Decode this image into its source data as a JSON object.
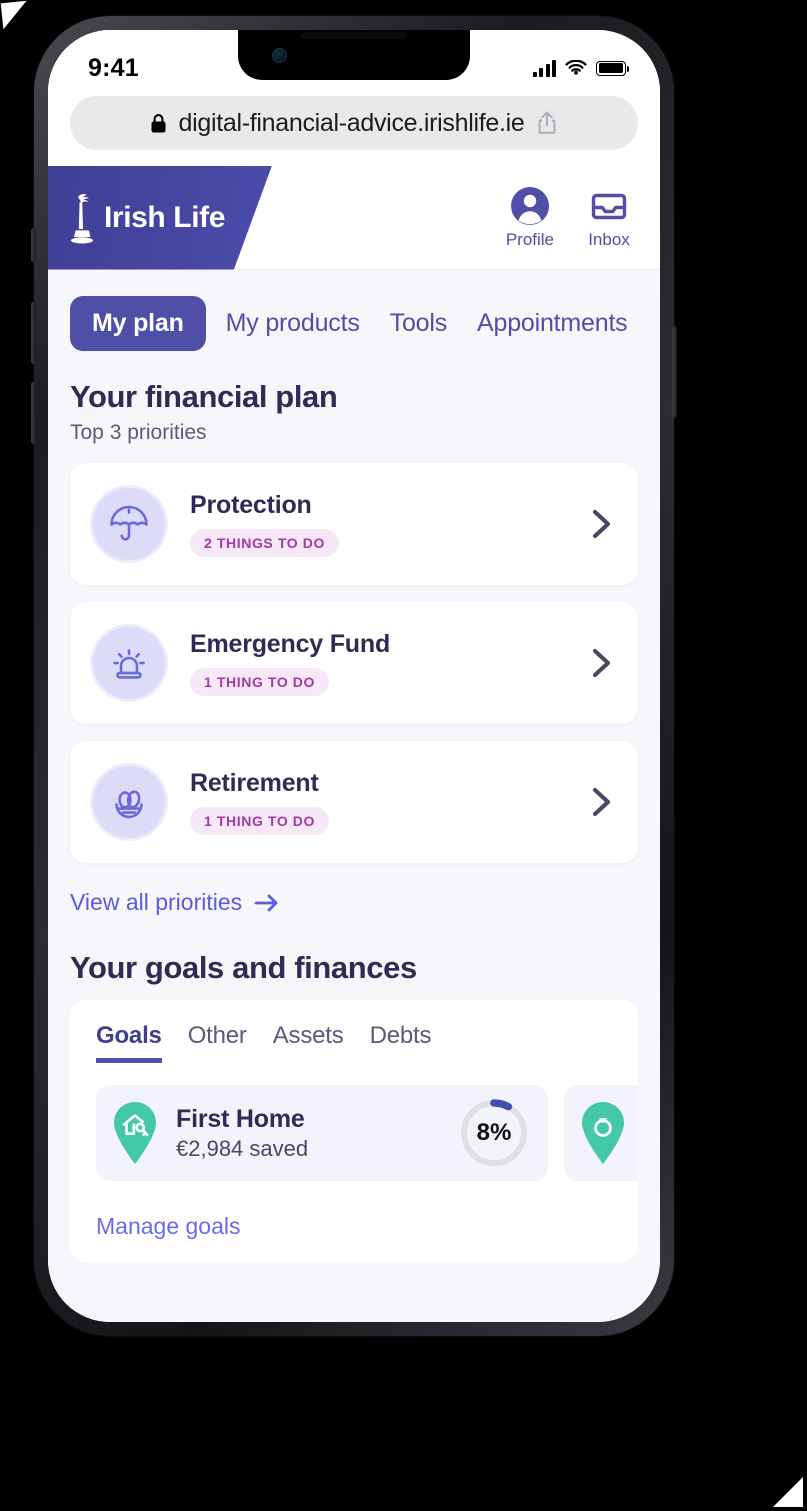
{
  "status_bar": {
    "time": "9:41",
    "signal_icon": "cellular-signal-icon",
    "wifi_icon": "wifi-icon",
    "battery_icon": "battery-icon"
  },
  "browser": {
    "lock_icon": "lock-icon",
    "url": "digital-financial-advice.irishlife.ie",
    "share_icon": "share-icon"
  },
  "header": {
    "brand": "Irish Life",
    "logo_icon": "irish-life-logo-icon",
    "actions": [
      {
        "label": "Profile",
        "icon": "profile-avatar-icon"
      },
      {
        "label": "Inbox",
        "icon": "inbox-tray-icon"
      }
    ]
  },
  "nav": {
    "tabs": [
      {
        "label": "My plan",
        "active": true
      },
      {
        "label": "My products",
        "active": false
      },
      {
        "label": "Tools",
        "active": false
      },
      {
        "label": "Appointments",
        "active": false
      }
    ]
  },
  "plan": {
    "title": "Your financial plan",
    "subtitle": "Top 3 priorities",
    "priorities": [
      {
        "title": "Protection",
        "badge": "2 THINGS TO DO",
        "icon": "umbrella-icon",
        "chevron": "chevron-right-icon"
      },
      {
        "title": "Emergency Fund",
        "badge": "1 THING TO DO",
        "icon": "alarm-siren-icon",
        "chevron": "chevron-right-icon"
      },
      {
        "title": "Retirement",
        "badge": "1 THING TO DO",
        "icon": "nest-egg-icon",
        "chevron": "chevron-right-icon"
      }
    ],
    "view_all_label": "View all priorities",
    "view_all_icon": "arrow-right-icon"
  },
  "goals_section": {
    "title": "Your goals and finances",
    "tabs": [
      {
        "label": "Goals",
        "active": true
      },
      {
        "label": "Other",
        "active": false
      },
      {
        "label": "Assets",
        "active": false
      },
      {
        "label": "Debts",
        "active": false
      }
    ],
    "goals": [
      {
        "name": "First Home",
        "saved": "€2,984 saved",
        "progress": "8%",
        "progress_value": 8,
        "icon": "home-key-pin-icon"
      },
      {
        "name": "",
        "saved": "",
        "progress": "",
        "progress_value": 0,
        "icon": "ring-pin-icon"
      }
    ],
    "manage_label": "Manage goals"
  },
  "colors": {
    "brand_purple": "#4f4fa8",
    "brand_deep": "#3f3f96",
    "page_bg": "#f7f7fb",
    "card_bg": "#ffffff",
    "heading": "#2f2b55",
    "badge_bg": "#f7e8f7",
    "badge_text": "#a13aa8",
    "goal_teal": "#43c9a7",
    "ring_track": "#e0e0e4",
    "ring_fill": "#4350b0"
  }
}
